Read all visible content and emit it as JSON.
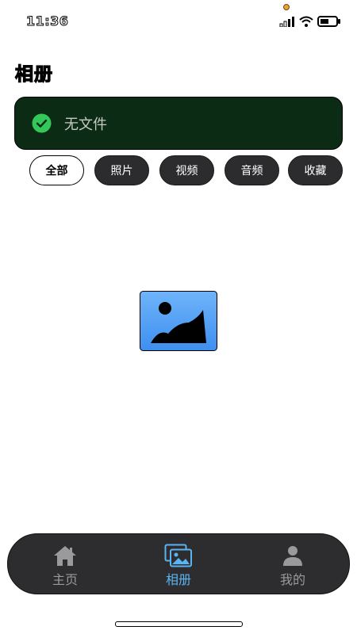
{
  "status_bar": {
    "time": "11:36",
    "icons": [
      "signal-icon",
      "wifi-icon",
      "battery-icon"
    ]
  },
  "page": {
    "title": "相册"
  },
  "banner": {
    "message": "无文件",
    "icon": "check-circle-icon",
    "background": "#0c2b14",
    "icon_color": "#34c759"
  },
  "tabs": [
    {
      "label": "全部",
      "active": true
    },
    {
      "label": "照片",
      "active": false
    },
    {
      "label": "视频",
      "active": false
    },
    {
      "label": "音频",
      "active": false
    },
    {
      "label": "收藏",
      "active": false
    }
  ],
  "empty_state": {
    "icon": "image-placeholder-icon"
  },
  "bottom_nav": {
    "items": [
      {
        "label": "主页",
        "icon": "home-icon",
        "active": false
      },
      {
        "label": "相册",
        "icon": "album-icon",
        "active": true
      },
      {
        "label": "我的",
        "icon": "person-icon",
        "active": false
      }
    ],
    "active_color": "#5ab4f2",
    "inactive_color": "#9a9a9c"
  }
}
